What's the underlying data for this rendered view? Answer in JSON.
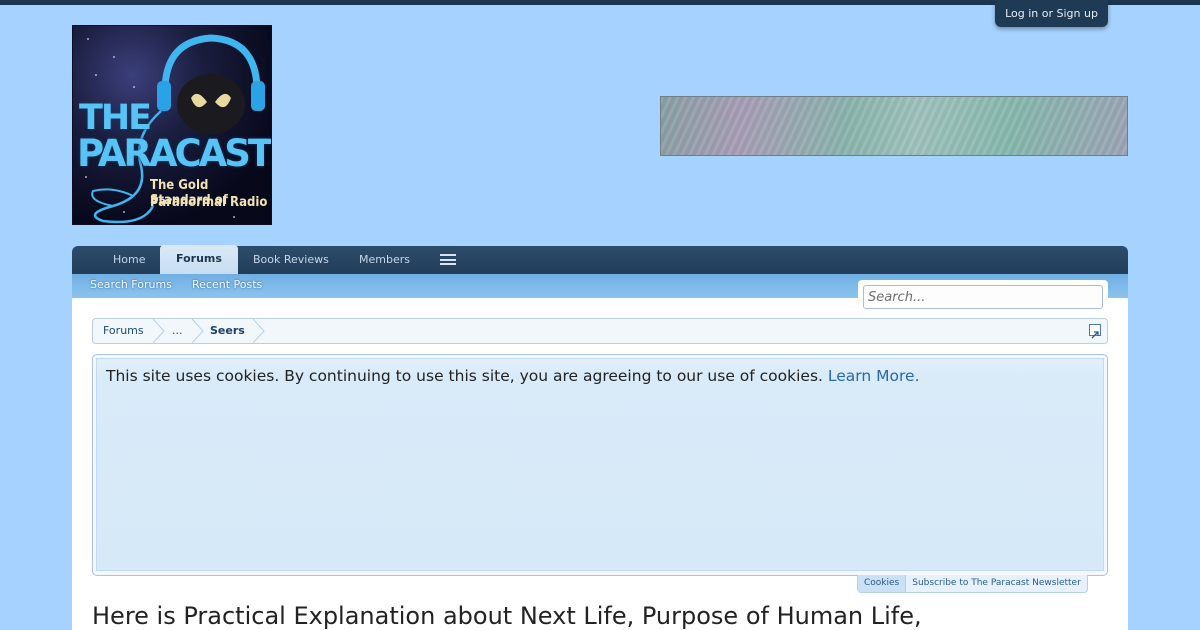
{
  "header": {
    "login_label": "Log in or Sign up",
    "logo": {
      "line1": "THE",
      "line2": "PARACAST",
      "tagline1": "The Gold Standard of",
      "tagline2": "Paranormal Radio"
    }
  },
  "nav": {
    "tabs": [
      {
        "label": "Home"
      },
      {
        "label": "Forums"
      },
      {
        "label": "Book Reviews"
      },
      {
        "label": "Members"
      }
    ],
    "active_tab": "Forums",
    "menu_icon": "hamburger-icon",
    "subnav": [
      {
        "label": "Search Forums"
      },
      {
        "label": "Recent Posts"
      }
    ]
  },
  "search": {
    "placeholder": "Search..."
  },
  "breadcrumb": {
    "items": [
      "Forums",
      "...",
      "Seers"
    ],
    "jump_icon": "jump-to-icon"
  },
  "notice": {
    "text": "This site uses cookies. By continuing to use this site, you are agreeing to our use of cookies.",
    "link": "Learn More.",
    "tabs": [
      "Cookies",
      "Subscribe to The Paracast Newsletter"
    ]
  },
  "thread": {
    "title": "Here is Practical Explanation about Next Life, Purpose of Human Life,"
  },
  "colors": {
    "page_bg": "#a6d2ff",
    "nav_bg": "#213d59",
    "subnav_bg": "#7ab7e8",
    "link": "#2668a8"
  }
}
